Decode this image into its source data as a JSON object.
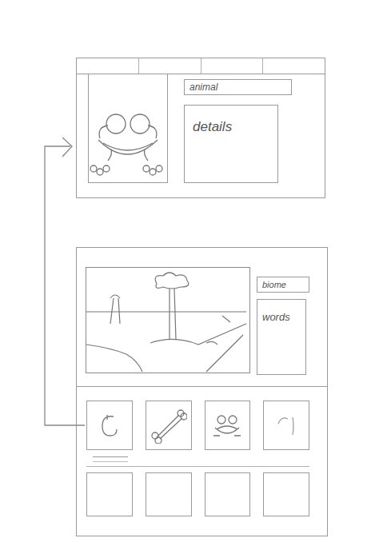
{
  "detail_view": {
    "tabs": [
      {
        "label": ""
      },
      {
        "label": ""
      },
      {
        "label": ""
      },
      {
        "label": ""
      }
    ],
    "title": "animal",
    "body": "details"
  },
  "list_view": {
    "title": "biome",
    "body": "words",
    "items": [
      {
        "kind": "icon",
        "selected": true
      },
      {
        "kind": "icon",
        "selected": false
      },
      {
        "kind": "icon",
        "selected": false
      },
      {
        "kind": "icon",
        "selected": false
      },
      {
        "kind": "empty",
        "selected": false
      },
      {
        "kind": "empty",
        "selected": false
      },
      {
        "kind": "empty",
        "selected": false
      },
      {
        "kind": "empty",
        "selected": false
      }
    ]
  }
}
